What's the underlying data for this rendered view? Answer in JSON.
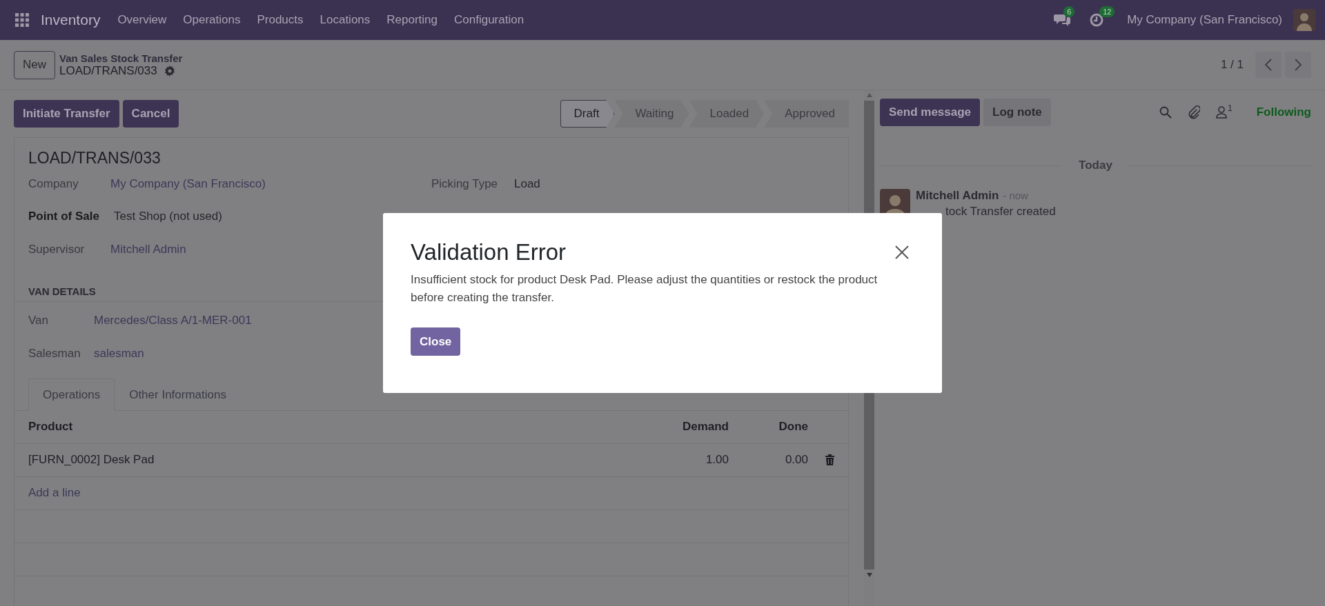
{
  "navbar": {
    "app": "Inventory",
    "menu": [
      "Overview",
      "Operations",
      "Products",
      "Locations",
      "Reporting",
      "Configuration"
    ],
    "messages_badge": "6",
    "activities_badge": "12",
    "company": "My Company (San Francisco)"
  },
  "control_panel": {
    "new_button": "New",
    "breadcrumb": "Van Sales Stock Transfer",
    "record": "LOAD/TRANS/033",
    "pager": "1 / 1"
  },
  "actions": [
    "Initiate Transfer",
    "Cancel"
  ],
  "stages": [
    {
      "label": "Draft",
      "selected": true
    },
    {
      "label": "Waiting",
      "selected": false
    },
    {
      "label": "Loaded",
      "selected": false
    },
    {
      "label": "Approved",
      "selected": false
    }
  ],
  "form": {
    "title": "LOAD/TRANS/033",
    "left_fields": [
      {
        "label": "Company",
        "value": "My Company (San Francisco)",
        "kind": "link"
      },
      {
        "label": "Point of Sale",
        "value": "Test Shop (not used)",
        "kind": "required"
      },
      {
        "label": "Supervisor",
        "value": "Mitchell Admin",
        "kind": "link"
      }
    ],
    "right_fields": [
      {
        "label": "Picking Type",
        "value": "Load",
        "kind": "plain"
      }
    ],
    "section": "VAN DETAILS",
    "van_fields": [
      {
        "label": "Van",
        "value": "Mercedes/Class A/1-MER-001",
        "kind": "link"
      },
      {
        "label": "Salesman",
        "value": "salesman",
        "kind": "link"
      }
    ]
  },
  "tabs": [
    {
      "label": "Operations",
      "selected": true
    },
    {
      "label": "Other Informations",
      "selected": false
    }
  ],
  "table": {
    "columns": [
      "Product",
      "Demand",
      "Done"
    ],
    "rows": [
      {
        "product": "[FURN_0002] Desk Pad",
        "demand": "1.00",
        "done": "0.00"
      }
    ],
    "add_line": "Add a line"
  },
  "chatter": {
    "buttons": [
      {
        "label": "Send message",
        "kind": "primary"
      },
      {
        "label": "Log note",
        "kind": "secondary"
      }
    ],
    "followers_count": "1",
    "follow_status": "Following",
    "date_divider": "Today",
    "messages": [
      {
        "author": "Mitchell Admin",
        "time": "- now",
        "body": "tock Transfer created"
      }
    ]
  },
  "dialog": {
    "title": "Validation Error",
    "message": "Insufficient stock for product Desk Pad. Please adjust the quantities or restock the product before creating the transfer.",
    "button": "Close"
  }
}
